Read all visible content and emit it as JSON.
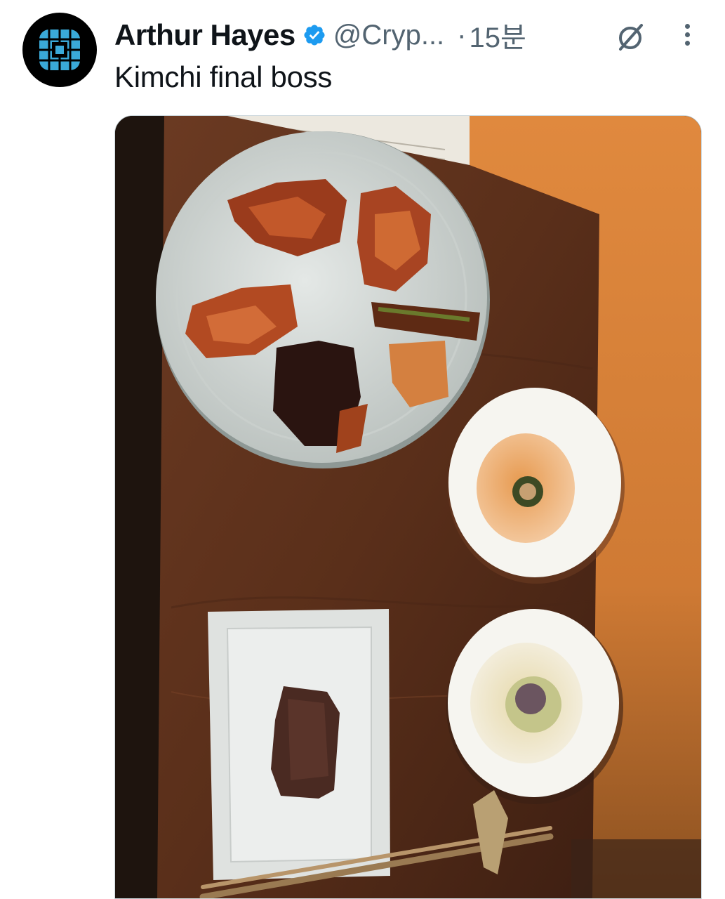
{
  "tweet": {
    "author": {
      "display_name": "Arthur Hayes",
      "handle": "@Cryp...",
      "verified": true,
      "avatar_icon": "square-grid-logo-icon"
    },
    "separator": "·",
    "timestamp": "15분",
    "text": "Kimchi final boss",
    "actions": {
      "grok_icon": "grok-icon",
      "more_icon": "more-vertical-icon"
    },
    "media": {
      "type": "photo",
      "alt_icon": "food-photo-image"
    }
  },
  "colors": {
    "text_primary": "#0f1419",
    "text_secondary": "#536471",
    "verified_blue": "#1d9bf0",
    "avatar_bg": "#000000",
    "logo_blue": "#3aa9d8"
  }
}
